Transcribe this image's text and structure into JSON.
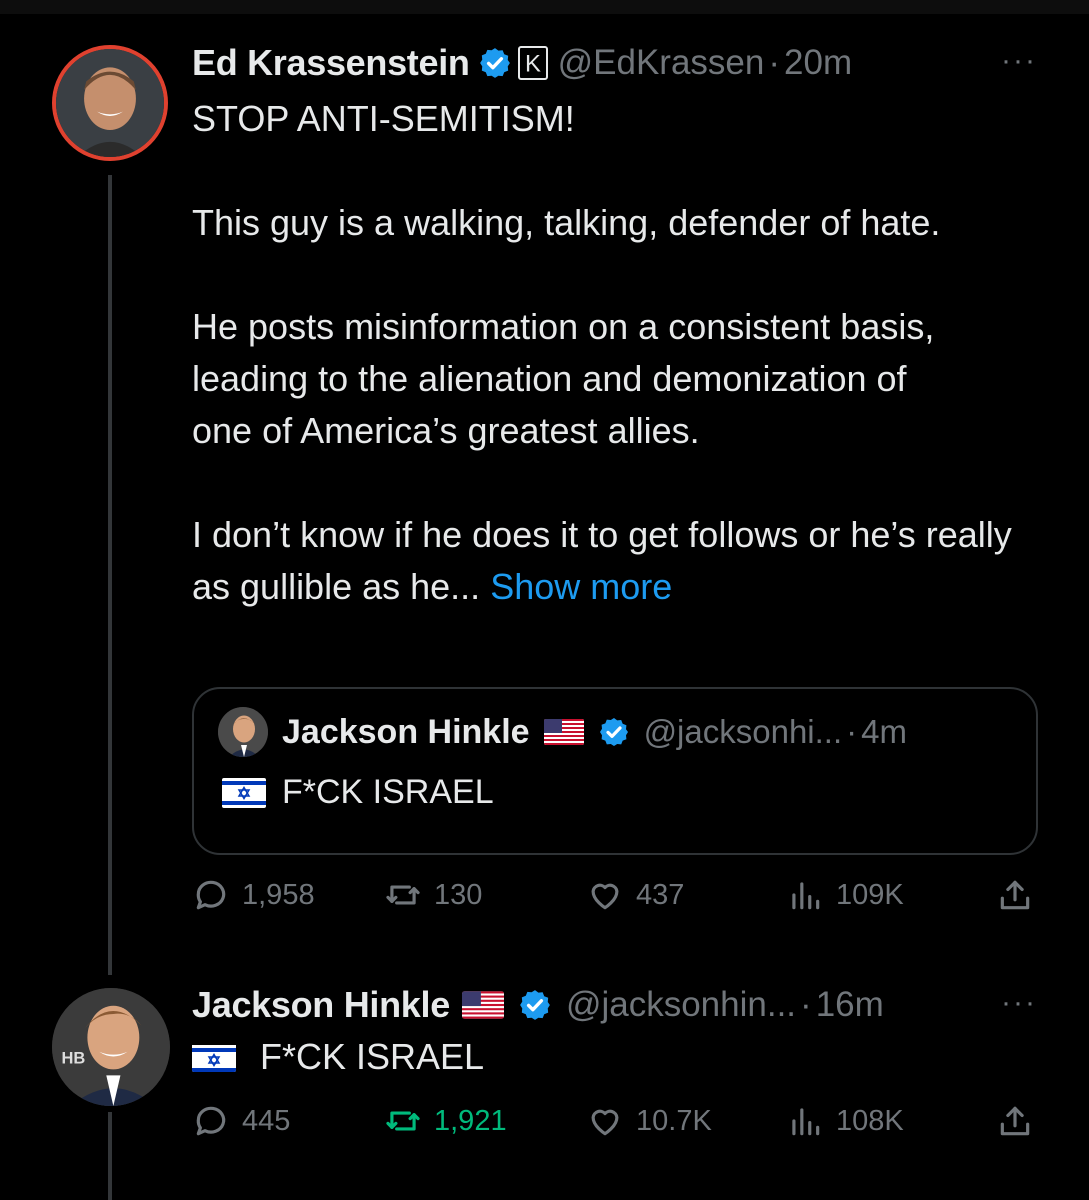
{
  "post1": {
    "author_name": "Ed Krassenstein",
    "handle": "@EdKrassen",
    "separator": "·",
    "time": "20m",
    "more_label": "···",
    "badge_letter": "K",
    "paragraphs": [
      "STOP ANTI-SEMITISM!",
      "This guy is a walking, talking, defender of hate.",
      "He posts misinformation on a consistent basis, leading to the alienation and demonization of one of America’s greatest allies.",
      "I don’t know if he does it to get follows or he’s really as gullible as he..."
    ],
    "show_more": "Show more",
    "quote": {
      "author_name": "Jackson Hinkle",
      "handle": "@jacksonhi...",
      "separator": "·",
      "time": "4m",
      "text": "F*CK ISRAEL"
    },
    "actions": {
      "replies": "1,958",
      "reposts": "130",
      "likes": "437",
      "views": "109K"
    }
  },
  "post2": {
    "author_name": "Jackson Hinkle",
    "handle": "@jacksonhin...",
    "separator": "·",
    "time": "16m",
    "more_label": "···",
    "text": "F*CK ISRAEL",
    "actions": {
      "replies": "445",
      "reposts": "1,921",
      "likes": "10.7K",
      "views": "108K"
    }
  },
  "colors": {
    "background": "#000000",
    "text": "#e7e9ea",
    "muted": "#71767b",
    "link": "#1d9bf0",
    "verified": "#1d9bf0",
    "repost_active": "#00ba7c",
    "avatar_ring": "#e0412f"
  }
}
